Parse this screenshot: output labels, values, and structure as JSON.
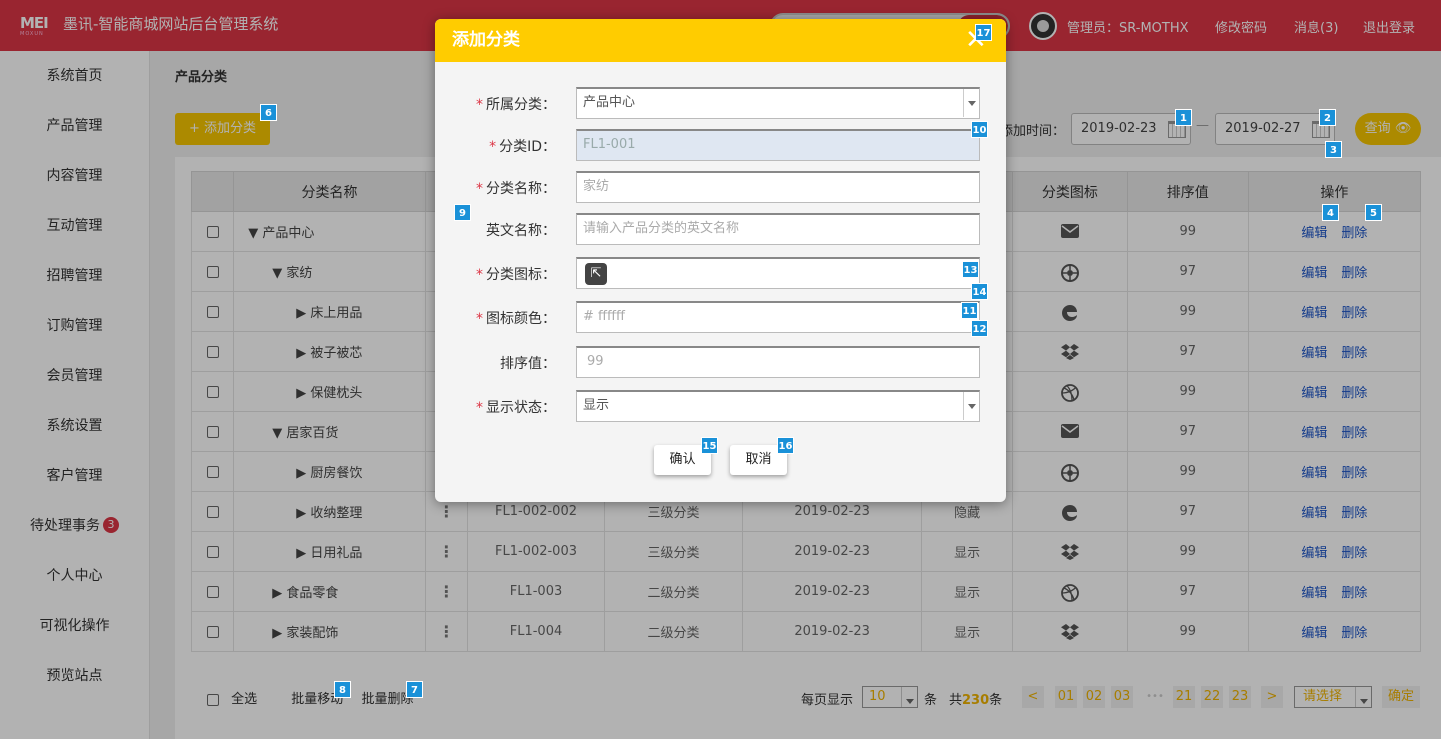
{
  "header": {
    "logo_text": "MEI",
    "logo_sub": "MOXUN",
    "title": "墨讯-智能商城网站后台管理系统",
    "admin": "管理员：SR-MOTHX",
    "change_password": "修改密码",
    "messages": "消息(3)",
    "logout": "退出登录"
  },
  "sidebar": {
    "items": [
      "系统首页",
      "产品管理",
      "内容管理",
      "互动管理",
      "招聘管理",
      "订购管理",
      "会员管理",
      "系统设置",
      "客户管理",
      "待处理事务",
      "个人中心",
      "可视化操作",
      "预览站点"
    ],
    "pending_badge": "3"
  },
  "page": {
    "breadcrumb": "产品分类",
    "add_button": "+ 添加分类",
    "date_label": "添加时间：",
    "date_from": "2019-02-23",
    "date_to": "2019-02-27",
    "query": "查询"
  },
  "table": {
    "headers": [
      "",
      "分类名称",
      "",
      "",
      "",
      "",
      "",
      "分类图标",
      "排序值",
      "操作"
    ],
    "edit": "编辑",
    "delete": "删除",
    "rows": [
      {
        "name": "▼ 产品中心",
        "indent": 0,
        "id": "",
        "level": "",
        "date": "",
        "status": "",
        "icon": "mail",
        "sort": "99"
      },
      {
        "name": "▼ 家纺",
        "indent": 1,
        "id": "",
        "level": "",
        "date": "",
        "status": "",
        "icon": "empire",
        "sort": "97"
      },
      {
        "name": "▶ 床上用品",
        "indent": 2,
        "id": "",
        "level": "",
        "date": "",
        "status": "",
        "icon": "edge",
        "sort": "99"
      },
      {
        "name": "▶ 被子被芯",
        "indent": 2,
        "id": "",
        "level": "",
        "date": "",
        "status": "",
        "icon": "dropbox",
        "sort": "97"
      },
      {
        "name": "▶ 保健枕头",
        "indent": 2,
        "id": "",
        "level": "",
        "date": "",
        "status": "",
        "icon": "dribbble",
        "sort": "99"
      },
      {
        "name": "▼ 居家百货",
        "indent": 1,
        "id": "",
        "level": "",
        "date": "",
        "status": "",
        "icon": "mail",
        "sort": "97"
      },
      {
        "name": "▶ 厨房餐饮",
        "indent": 2,
        "id": "",
        "level": "",
        "date": "",
        "status": "",
        "icon": "empire",
        "sort": "99"
      },
      {
        "name": "▶ 收纳整理",
        "indent": 2,
        "id": "FL1-002-002",
        "level": "三级分类",
        "date": "2019-02-23",
        "status": "隐藏",
        "icon": "edge",
        "sort": "97"
      },
      {
        "name": "▶ 日用礼品",
        "indent": 2,
        "id": "FL1-002-003",
        "level": "三级分类",
        "date": "2019-02-23",
        "status": "显示",
        "icon": "dropbox",
        "sort": "99"
      },
      {
        "name": "▶ 食品零食",
        "indent": 1,
        "id": "FL1-003",
        "level": "二级分类",
        "date": "2019-02-23",
        "status": "显示",
        "icon": "dribbble",
        "sort": "97"
      },
      {
        "name": "▶ 家装配饰",
        "indent": 1,
        "id": "FL1-004",
        "level": "二级分类",
        "date": "2019-02-23",
        "status": "显示",
        "icon": "dropbox",
        "sort": "99"
      }
    ]
  },
  "footer": {
    "select_all": "全选",
    "batch_move": "批量移动",
    "batch_delete": "批量删除",
    "per_page": "每页显示",
    "per_page_value": "10",
    "unit": "条",
    "total_prefix": "共",
    "total": "230",
    "total_suffix": "条",
    "prev": "<",
    "next": ">",
    "pages": [
      "01",
      "02",
      "03",
      "21",
      "22",
      "23"
    ],
    "ellipsis": "•••",
    "choose": "请选择",
    "confirm": "确定"
  },
  "modal": {
    "title": "添加分类",
    "fields": {
      "parent": {
        "label": "所属分类：",
        "value": "产品中心"
      },
      "id": {
        "label": "分类ID：",
        "value": "FL1-001"
      },
      "name": {
        "label": "分类名称：",
        "placeholder": "家纺"
      },
      "en_name": {
        "label": "英文名称：",
        "placeholder": "请输入产品分类的英文名称"
      },
      "icon": {
        "label": "分类图标："
      },
      "color": {
        "label": "图标颜色：",
        "placeholder": "# ffffff"
      },
      "sort": {
        "label": "排序值：",
        "placeholder": "99"
      },
      "status": {
        "label": "显示状态：",
        "value": "显示"
      }
    },
    "ok": "确认",
    "cancel": "取消"
  },
  "markers": [
    "1",
    "2",
    "3",
    "4",
    "5",
    "6",
    "7",
    "8",
    "9",
    "10",
    "11",
    "12",
    "13",
    "14",
    "15",
    "16",
    "17"
  ],
  "colors": {
    "brand_red": "#dc3545",
    "accent_yellow": "#ffcc00",
    "marker_blue": "#1a91d8"
  }
}
